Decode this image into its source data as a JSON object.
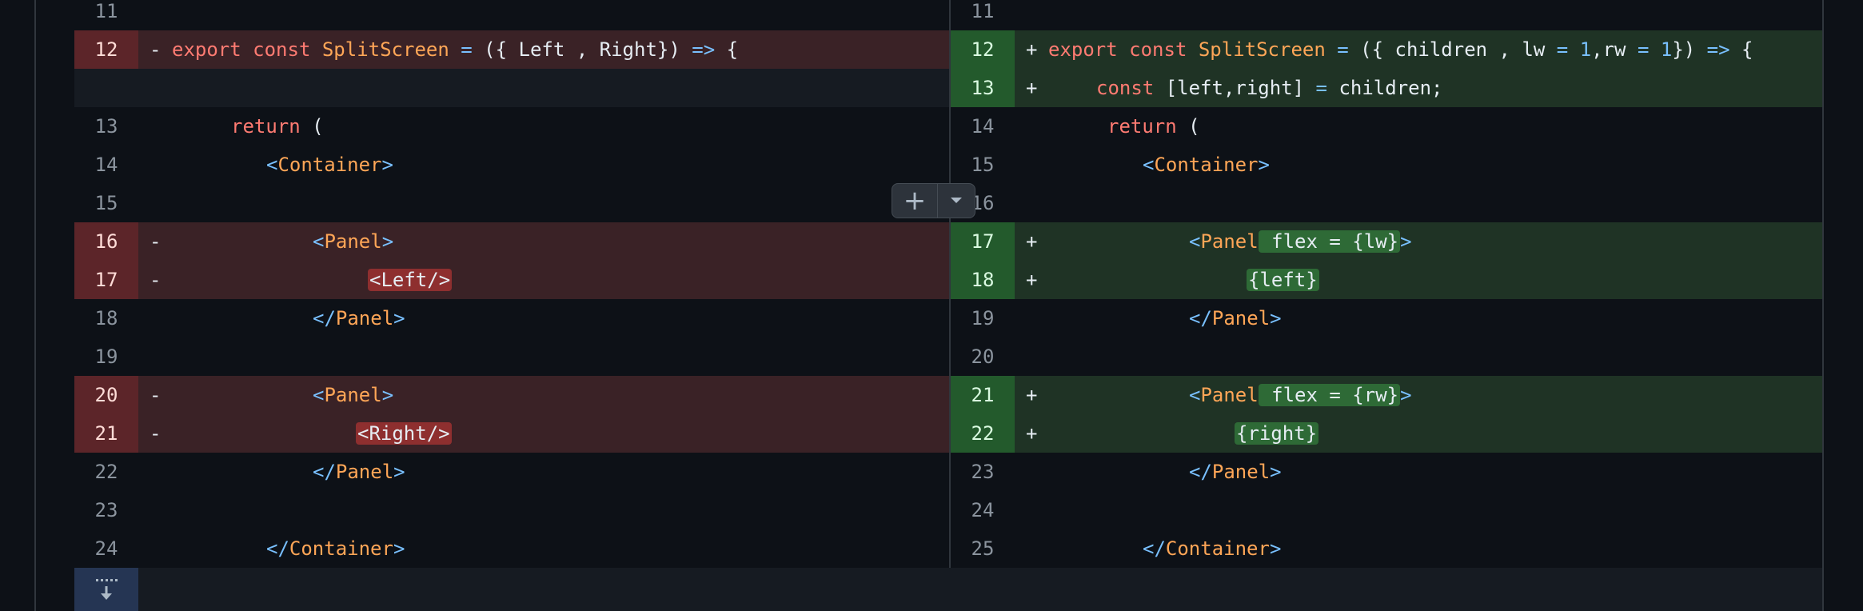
{
  "add_button": {
    "plus_icon": "plus-icon",
    "caret_icon": "chevron-down-icon"
  },
  "expand_button": {
    "icon": "unfold-down-icon"
  },
  "colors": {
    "deleted": "#3a2226",
    "added": "#1f3325",
    "keyword": "#ff7b72",
    "tag": "#ffa657",
    "operator": "#79c0ff"
  },
  "rows": [
    {
      "left": {
        "num": "11",
        "type": "ctx"
      },
      "right": {
        "num": "11",
        "type": "ctx"
      }
    },
    {
      "left": {
        "num": "12",
        "type": "del",
        "marker": "-"
      },
      "right": {
        "num": "12",
        "type": "add",
        "marker": "+"
      }
    },
    {
      "left": {
        "num": "",
        "type": "empty"
      },
      "right": {
        "num": "13",
        "type": "add",
        "marker": "+"
      }
    },
    {
      "left": {
        "num": "13",
        "type": "ctx"
      },
      "right": {
        "num": "14",
        "type": "ctx"
      }
    },
    {
      "left": {
        "num": "14",
        "type": "ctx"
      },
      "right": {
        "num": "15",
        "type": "ctx"
      }
    },
    {
      "left": {
        "num": "15",
        "type": "ctx"
      },
      "right": {
        "num": "16",
        "type": "ctx"
      }
    },
    {
      "left": {
        "num": "16",
        "type": "del",
        "marker": "-"
      },
      "right": {
        "num": "17",
        "type": "add",
        "marker": "+"
      }
    },
    {
      "left": {
        "num": "17",
        "type": "del",
        "marker": "-"
      },
      "right": {
        "num": "18",
        "type": "add",
        "marker": "+"
      }
    },
    {
      "left": {
        "num": "18",
        "type": "ctx"
      },
      "right": {
        "num": "19",
        "type": "ctx"
      }
    },
    {
      "left": {
        "num": "19",
        "type": "ctx"
      },
      "right": {
        "num": "20",
        "type": "ctx"
      }
    },
    {
      "left": {
        "num": "20",
        "type": "del",
        "marker": "-"
      },
      "right": {
        "num": "21",
        "type": "add",
        "marker": "+"
      }
    },
    {
      "left": {
        "num": "21",
        "type": "del",
        "marker": "-"
      },
      "right": {
        "num": "22",
        "type": "add",
        "marker": "+"
      }
    },
    {
      "left": {
        "num": "22",
        "type": "ctx"
      },
      "right": {
        "num": "23",
        "type": "ctx"
      }
    },
    {
      "left": {
        "num": "23",
        "type": "ctx"
      },
      "right": {
        "num": "24",
        "type": "ctx"
      }
    },
    {
      "left": {
        "num": "24",
        "type": "ctx"
      },
      "right": {
        "num": "25",
        "type": "ctx"
      }
    }
  ],
  "code": {
    "L12": {
      "t1": "export const ",
      "name": "SplitScreen",
      "t2": " = ",
      "args": "({ Left , Right})",
      "arrow": " => ",
      "brace": "{"
    },
    "R12": {
      "t1": "export const ",
      "name": "SplitScreen",
      "t2": " = ",
      "args_a": "({ children , lw ",
      "eq1": "=",
      "one1": " 1",
      "args_b": ",rw ",
      "eq2": "=",
      "one2": " 1",
      "args_c": "})",
      "arrow": " => ",
      "brace": "{"
    },
    "R13": {
      "kw": "const ",
      "destr": "[left,right]",
      "eq": " = ",
      "rest": "children;"
    },
    "ret": {
      "kw": "return",
      "paren": " ("
    },
    "container_open": {
      "lt": "<",
      "tag": "Container",
      "gt": ">"
    },
    "panel_open": {
      "lt": "<",
      "tag": "Panel",
      "gt": ">"
    },
    "panel_close": {
      "lt": "</",
      "tag": "Panel",
      "gt": ">"
    },
    "container_close": {
      "lt": "</",
      "tag": "Container",
      "gt": ">"
    },
    "left_comp": "<Left/>",
    "right_comp": "<Right/>",
    "flex_lw": " flex = {lw}",
    "flex_rw": " flex = {rw}",
    "left_expr": "{left}",
    "right_expr": "{right}"
  }
}
